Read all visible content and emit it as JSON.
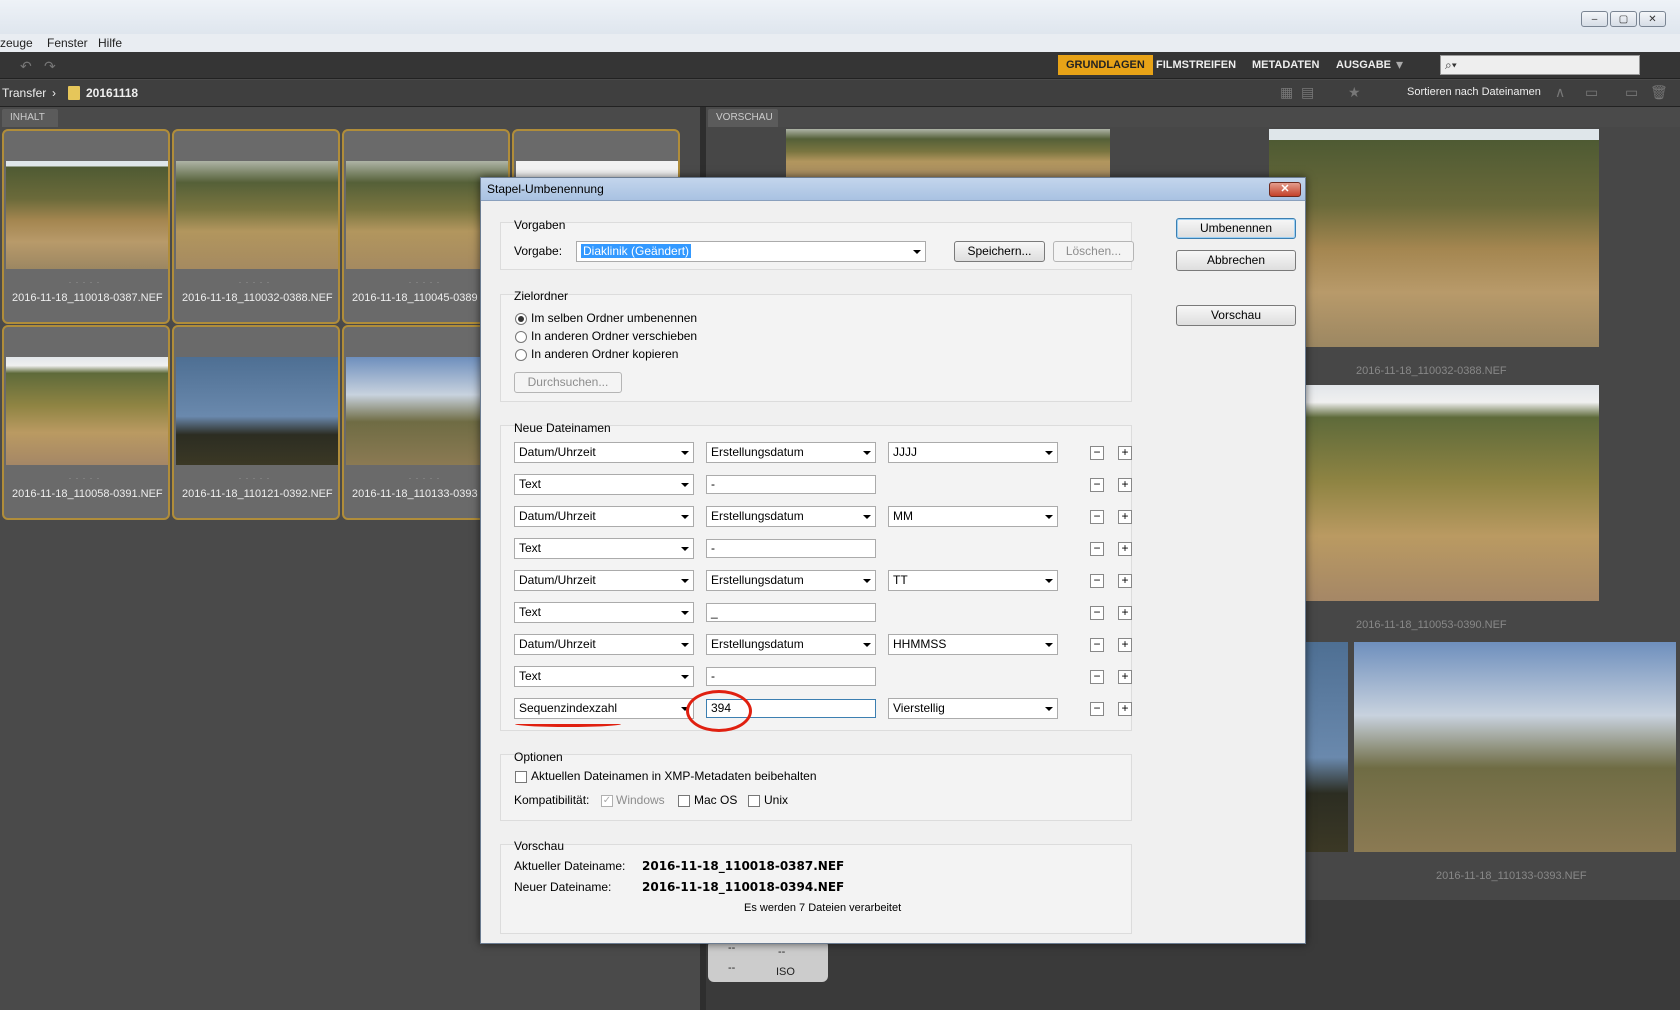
{
  "menu": {
    "items": [
      "zeuge",
      "Fenster",
      "Hilfe"
    ]
  },
  "workspaces": {
    "grundlagen": "GRUNDLAGEN",
    "filmstreifen": "FILMSTREIFEN",
    "metadaten": "METADATEN",
    "ausgabe": "AUSGABE"
  },
  "path": {
    "root": "Transfer",
    "folder": "20161118"
  },
  "sort_label": "Sortieren nach Dateinamen",
  "panels": {
    "content": "INHALT",
    "preview": "VORSCHAU"
  },
  "thumbnails": [
    "2016-11-18_110018-0387.NEF",
    "2016-11-18_110032-0388.NEF",
    "2016-11-18_110045-0389",
    "2016-11-18_110058-0391.NEF",
    "2016-11-18_110121-0392.NEF",
    "2016-11-18_110133-0393"
  ],
  "previews": {
    "p1": "2016-11-18_110032-0388.NEF",
    "p2": "2016-11-18_110053-0390.NEF",
    "p3": "2016-11-18_110133-0393.NEF"
  },
  "metadata": {
    "dashes": "--",
    "iso": "ISO"
  },
  "dialog": {
    "title": "Stapel-Umbenennung",
    "buttons": {
      "rename": "Umbenennen",
      "cancel": "Abbrechen",
      "preview": "Vorschau"
    },
    "presets": {
      "title": "Vorgaben",
      "label": "Vorgabe:",
      "value": "Diaklinik (Geändert)",
      "save": "Speichern...",
      "delete": "Löschen..."
    },
    "destination": {
      "title": "Zielordner",
      "same": "Im selben Ordner umbenennen",
      "move": "In anderen Ordner verschieben",
      "copy": "In anderen Ordner kopieren",
      "browse": "Durchsuchen..."
    },
    "new_names": {
      "title": "Neue Dateinamen",
      "rows": [
        {
          "type": "Datum/Uhrzeit",
          "b": "Erstellungsdatum",
          "c": "JJJJ"
        },
        {
          "type": "Text",
          "b": "-"
        },
        {
          "type": "Datum/Uhrzeit",
          "b": "Erstellungsdatum",
          "c": "MM"
        },
        {
          "type": "Text",
          "b": "-"
        },
        {
          "type": "Datum/Uhrzeit",
          "b": "Erstellungsdatum",
          "c": "TT"
        },
        {
          "type": "Text",
          "b": "_"
        },
        {
          "type": "Datum/Uhrzeit",
          "b": "Erstellungsdatum",
          "c": "HHMMSS"
        },
        {
          "type": "Text",
          "b": "-"
        },
        {
          "type": "Sequenzindexzahl",
          "b": "394",
          "c": "Vierstellig"
        }
      ]
    },
    "options": {
      "title": "Optionen",
      "keep_xmp": "Aktuellen Dateinamen in XMP-Metadaten beibehalten",
      "compat_label": "Kompatibilität:",
      "windows": "Windows",
      "macos": "Mac OS",
      "unix": "Unix"
    },
    "preview": {
      "title": "Vorschau",
      "current_label": "Aktueller Dateiname:",
      "current_value": "2016-11-18_110018-0387.NEF",
      "new_label": "Neuer Dateiname:",
      "new_value": "2016-11-18_110018-0394.NEF",
      "count": "Es werden 7 Dateien verarbeitet"
    }
  },
  "colors": {
    "accent": "#e8a317",
    "annotation": "#e02010",
    "selection": "#3399ff"
  }
}
